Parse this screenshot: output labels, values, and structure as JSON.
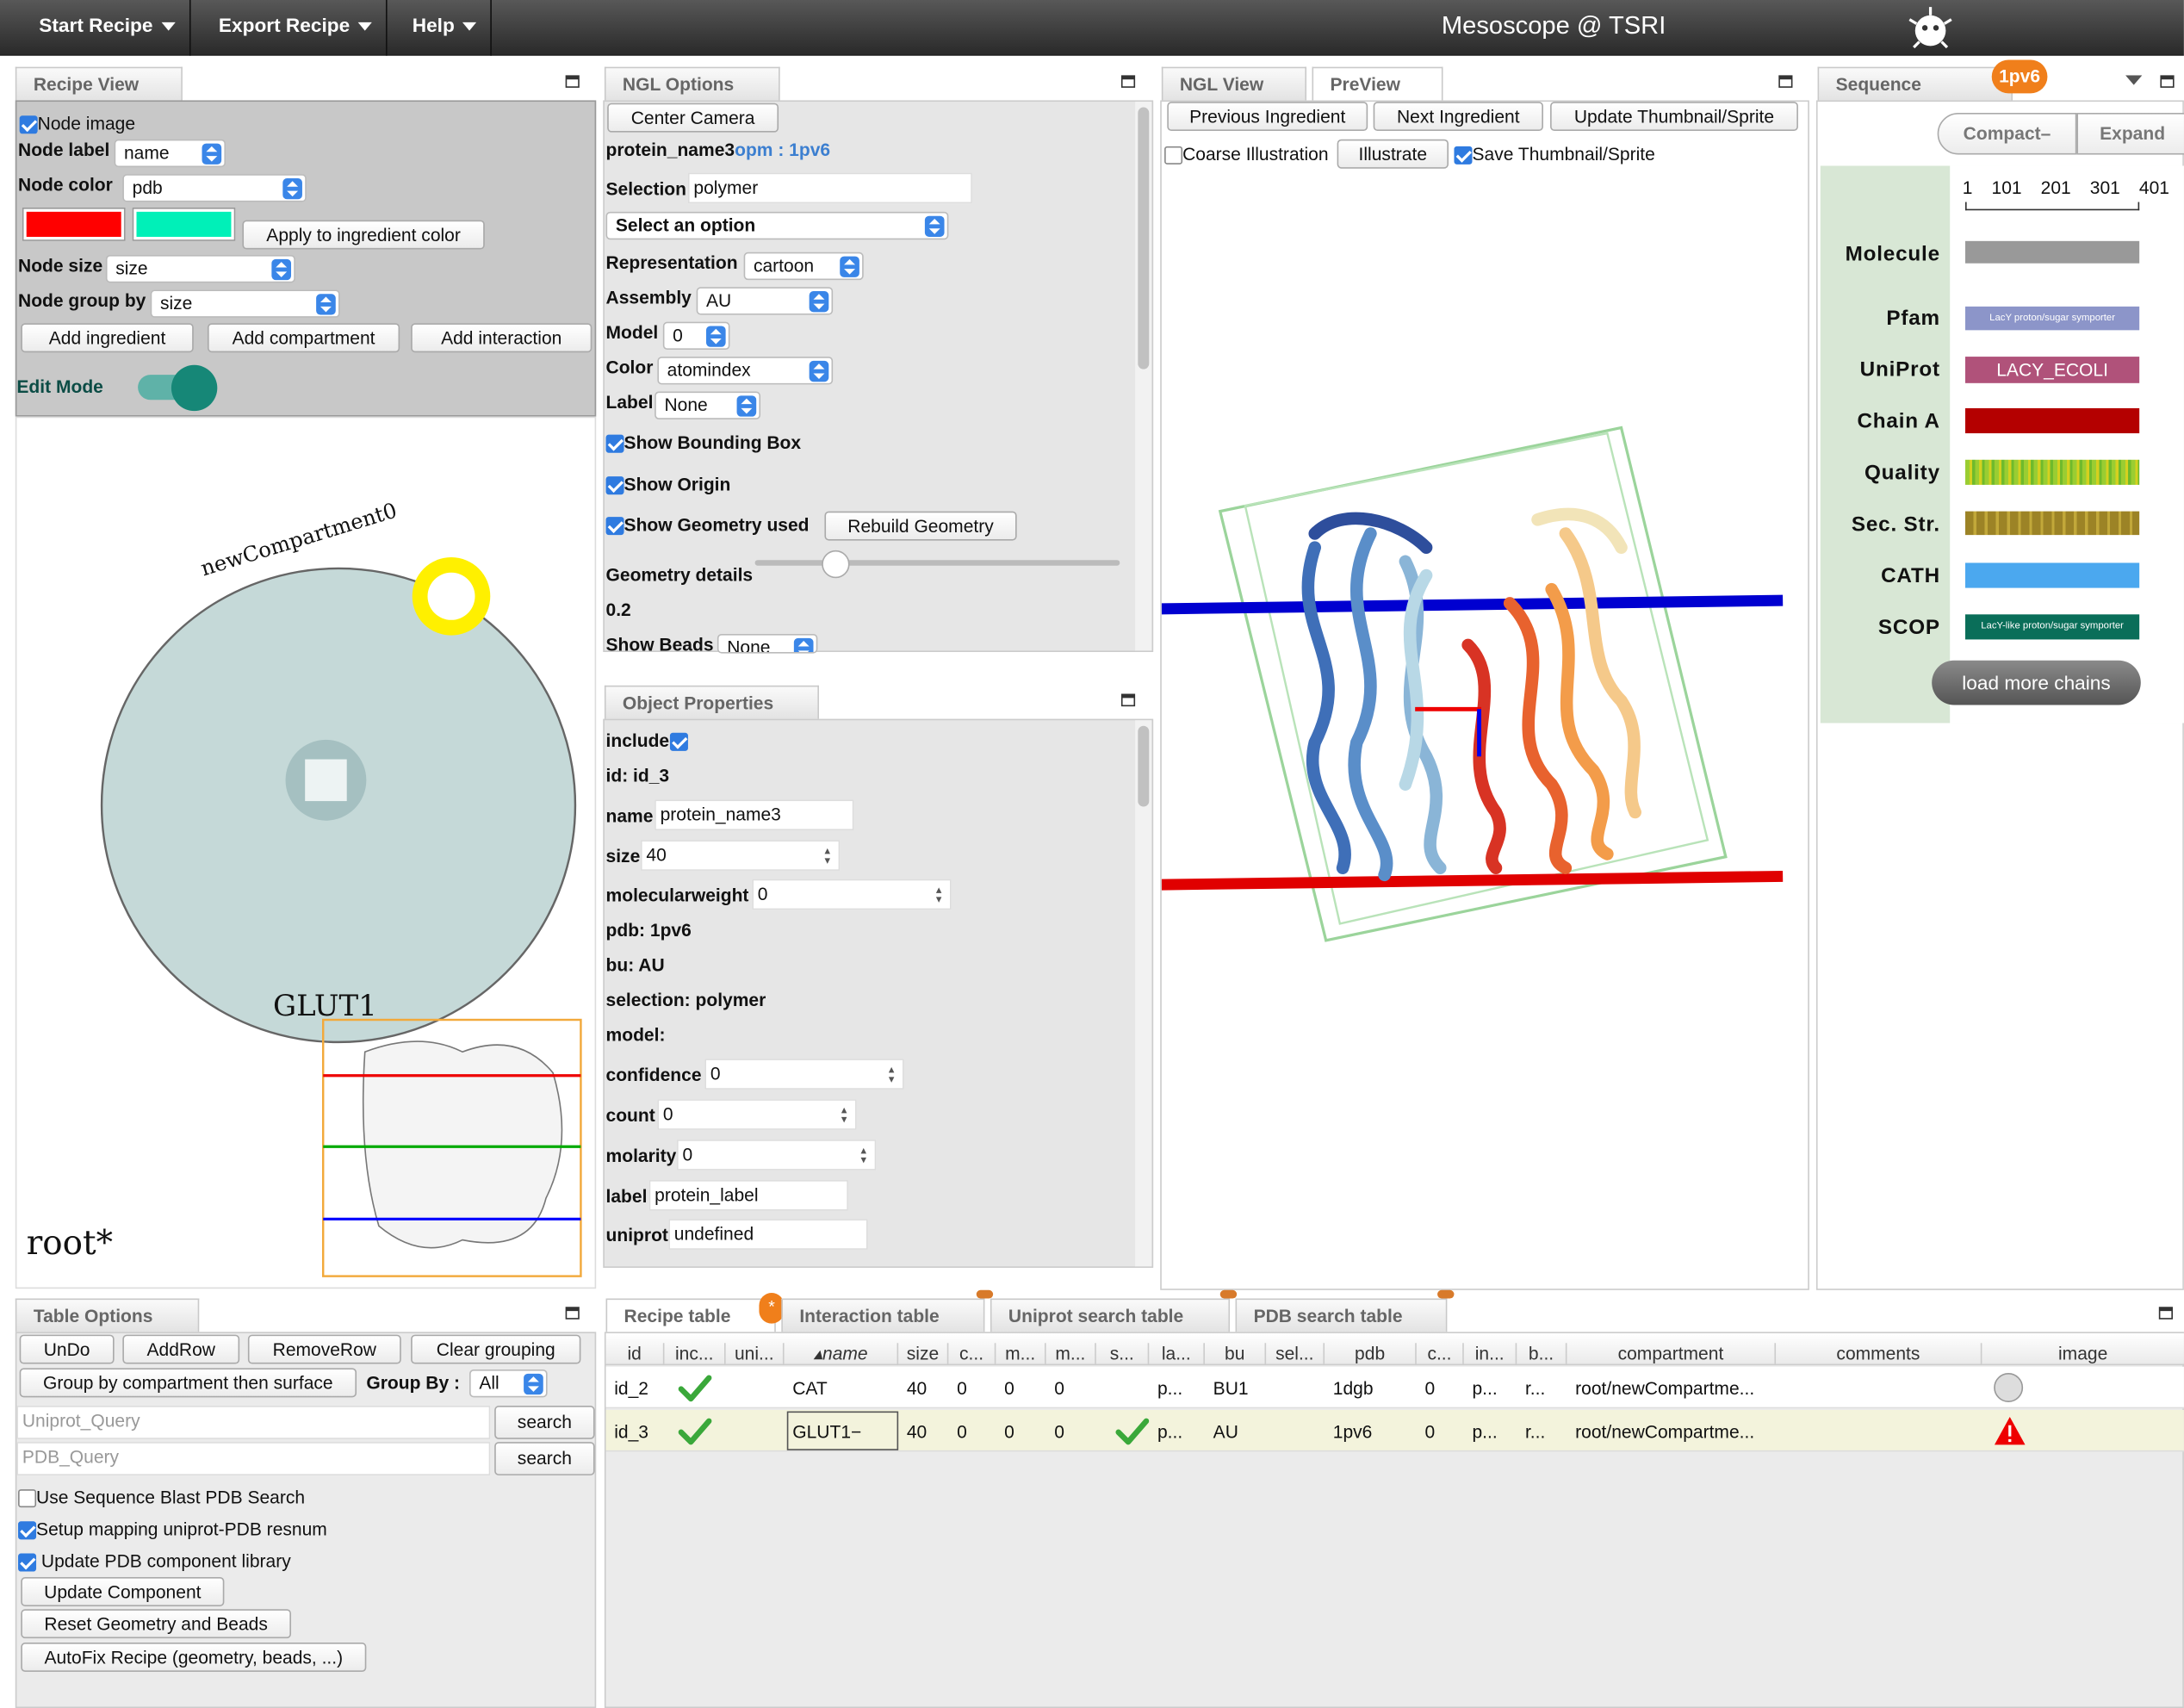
{
  "topbar": {
    "menus": [
      "Start Recipe",
      "Export Recipe",
      "Help"
    ],
    "title": "Mesoscope @ TSRI"
  },
  "recipe_view": {
    "tab": "Recipe View",
    "node_image": "Node image",
    "node_label": "Node label",
    "node_label_value": "name",
    "node_color": "Node color",
    "node_color_value": "pdb",
    "apply": "Apply to ingredient color",
    "node_size": "Node size",
    "node_size_value": "size",
    "node_group": "Node group by",
    "node_group_value": "size",
    "add_ingredient": "Add ingredient",
    "add_compartment": "Add compartment",
    "add_interaction": "Add interaction",
    "edit_mode": "Edit Mode",
    "compartment_name": "newCompartment0",
    "ingredient_label": "GLUT1",
    "root": "root*",
    "color1": "#ff0000",
    "color2": "#00f0b8"
  },
  "ngl_options": {
    "tab": "NGL Options",
    "center_camera": "Center Camera",
    "protein": "protein_name3",
    "opm": "opm : 1pv6",
    "selection_label": "Selection",
    "selection_value": "polymer",
    "select_option": "Select an option",
    "representation_label": "Representation",
    "representation_value": "cartoon",
    "assembly_label": "Assembly",
    "assembly_value": "AU",
    "model_label": "Model",
    "model_value": "0",
    "color_label": "Color",
    "color_value": "atomindex",
    "label_label": "Label",
    "label_value": "None",
    "show_bbox": "Show Bounding Box",
    "show_origin": "Show Origin",
    "show_geometry": "Show Geometry used",
    "rebuild": "Rebuild Geometry",
    "geom_details": "Geometry details",
    "geom_value": "0.2",
    "show_beads": "Show Beads",
    "show_beads_value": "None"
  },
  "object_props": {
    "tab": "Object Properties",
    "include": "include",
    "id": "id: id_3",
    "name_label": "name",
    "name_value": "protein_name3",
    "size_label": "size",
    "size_value": "40",
    "mw_label": "molecularweight",
    "mw_value": "0",
    "pdb": "pdb: 1pv6",
    "bu": "bu: AU",
    "selection": "selection: polymer",
    "model": "model:",
    "confidence_label": "confidence",
    "confidence_value": "0",
    "count_label": "count",
    "count_value": "0",
    "molarity_label": "molarity",
    "molarity_value": "0",
    "label_label": "label",
    "label_value": "protein_label",
    "uniprot_label": "uniprot",
    "uniprot_value": "undefined"
  },
  "ngl_view": {
    "tab": "NGL View",
    "tab2": "PreView",
    "prev": "Previous Ingredient",
    "next": "Next Ingredient",
    "update": "Update Thumbnail/Sprite",
    "coarse": "Coarse Illustration",
    "illustrate": "Illustrate",
    "save": "Save Thumbnail/Sprite"
  },
  "sequence": {
    "tab": "Sequence features",
    "badge": "1pv6",
    "compact": "Compact–",
    "expand": "Expand",
    "ticks": [
      "1",
      "101",
      "201",
      "301",
      "401"
    ],
    "rows": [
      "Molecule",
      "Pfam",
      "UniProt",
      "Chain A",
      "Quality",
      "Sec. Str.",
      "CATH",
      "SCOP"
    ],
    "pfam_text": "LacY proton/sugar symporter",
    "uniprot_text": "LACY_ECOLI",
    "scop_text": "LacY-like proton/sugar symporter",
    "load_more": "load more chains"
  },
  "table_options": {
    "tab": "Table Options",
    "undo": "UnDo",
    "addrow": "AddRow",
    "removerow": "RemoveRow",
    "clear": "Clear grouping",
    "group_btn": "Group by compartment then surface",
    "group_by": "Group By :",
    "group_value": "All",
    "uniprot_ph": "Uniprot_Query",
    "pdb_ph": "PDB_Query",
    "search": "search",
    "blast": "Use Sequence Blast PDB Search",
    "mapping": "Setup mapping uniprot-PDB resnum",
    "update_lib": "Update PDB component library",
    "update_comp": "Update Component",
    "reset": "Reset Geometry and Beads",
    "autofix": "AutoFix Recipe (geometry, beads, ...)"
  },
  "tables": {
    "tabs": [
      "Recipe table",
      "Interaction table",
      "Uniprot search table",
      "PDB search table"
    ],
    "badge": "*",
    "headers": [
      "id",
      "inc...",
      "uni...",
      "name",
      "size",
      "c...",
      "m...",
      "m...",
      "s...",
      "la...",
      "bu",
      "sel...",
      "pdb",
      "c...",
      "in...",
      "b...",
      "compartment",
      "comments",
      "image"
    ],
    "rows": [
      [
        "id_2",
        "",
        "",
        "CAT",
        "40",
        "0",
        "0",
        "0",
        "",
        "p...",
        "BU1",
        "",
        "1dgb",
        "0",
        "p...",
        "r...",
        "root/newCompartme...",
        "",
        ""
      ],
      [
        "id_3",
        "",
        "",
        "GLUT1−",
        "40",
        "0",
        "0",
        "0",
        "",
        "p...",
        "AU",
        "",
        "1pv6",
        "0",
        "p...",
        "r...",
        "root/newCompartme...",
        "",
        ""
      ]
    ]
  }
}
